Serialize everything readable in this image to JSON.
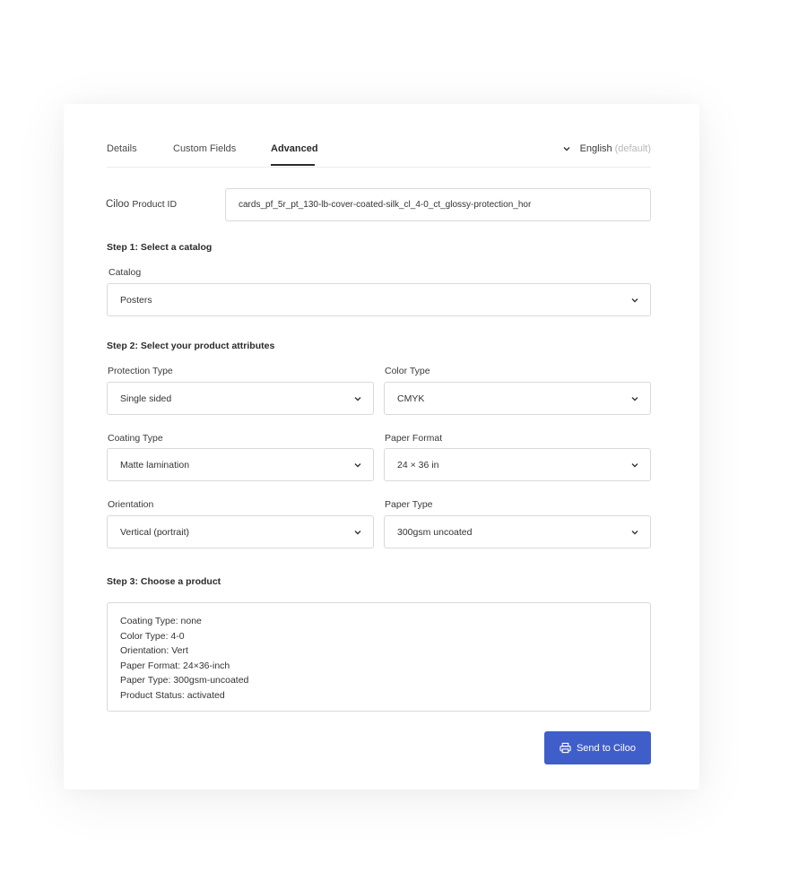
{
  "tabs": [
    {
      "label": "Details"
    },
    {
      "label": "Custom Fields"
    },
    {
      "label": "Advanced"
    }
  ],
  "active_tab": "Advanced",
  "language": {
    "label": "English",
    "note": "(default)"
  },
  "product_id": {
    "label_brand": "Ciloo",
    "label_rest": "Product ID",
    "value": "cards_pf_5r_pt_130-lb-cover-coated-silk_cl_4-0_ct_glossy-protection_hor"
  },
  "step1": {
    "title": "Step 1: Select a catalog",
    "catalog_label": "Catalog",
    "catalog_value": "Posters"
  },
  "step2": {
    "title": "Step 2: Select your product attributes",
    "protection_type": {
      "label": "Protection Type",
      "value": "Single sided"
    },
    "color_type": {
      "label": "Color Type",
      "value": "CMYK"
    },
    "coating_type": {
      "label": "Coating Type",
      "value": "Matte lamination"
    },
    "paper_format": {
      "label": "Paper Format",
      "value": "24 × 36 in"
    },
    "orientation": {
      "label": "Orientation",
      "value": "Vertical (portrait)"
    },
    "paper_type": {
      "label": "Paper Type",
      "value": "300gsm uncoated"
    }
  },
  "step3": {
    "title": "Step 3: Choose a product",
    "lines": [
      "Coating Type: none",
      "Color Type: 4-0",
      "Orientation: Vert",
      "Paper Format: 24×36-inch",
      "Paper Type: 300gsm-uncoated",
      "Product Status: activated"
    ]
  },
  "send_button": {
    "label": "Send to Ciloo",
    "icon": "printer-icon"
  },
  "colors": {
    "accent": "#3f5ec9"
  }
}
